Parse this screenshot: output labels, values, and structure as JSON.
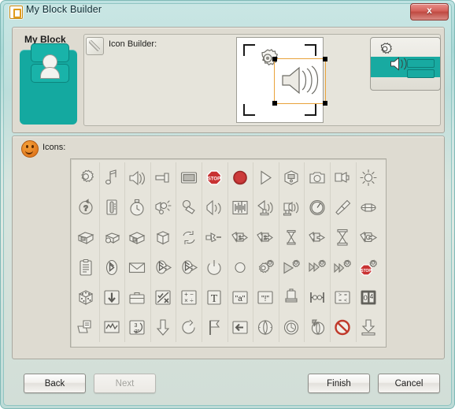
{
  "window": {
    "title": "My Block Builder",
    "title_icon": "block-icon",
    "close_label": "x"
  },
  "left_panel": {
    "heading": "My Block",
    "thumbnail_icon": "my-block-thumbnail",
    "accent_color": "#14a9a0"
  },
  "builder": {
    "pencil_icon": "pencil-icon",
    "label": "Icon Builder:",
    "canvas": {
      "items": [
        "gear-icon",
        "speaker-icon"
      ],
      "selected": "speaker-icon",
      "selection_color": "#e9a23b"
    },
    "preview_icon": "my-block-preview"
  },
  "icons_section": {
    "badge_icon": "smiley-icon",
    "label": "Icons:",
    "grid": {
      "columns": 12,
      "rows": 6,
      "items": [
        "gear-icon",
        "music-note-icon",
        "speaker-icon",
        "flashlight-icon",
        "display-icon",
        "stop-sign-icon",
        "red-button-icon",
        "play-icon",
        "nxt-brick-icon",
        "camera-icon",
        "lamp-icon",
        "sun-icon",
        "question-loop-icon",
        "thermometer-icon",
        "stopwatch-icon",
        "light-sensor-icon",
        "sound-sensor-icon",
        "sound-wave-icon",
        "waveform-icon",
        "satellite-icon",
        "microphone-icon",
        "dial-icon",
        "screwdriver-icon",
        "motor-icon",
        "brick-open-icon",
        "brick-roller-icon",
        "brick-closed-icon",
        "cube-icon",
        "loop-arrows-icon",
        "send-icon",
        "data-in-icon",
        "data-out-icon",
        "hourglass-small-icon",
        "text-send-icon",
        "hourglass-icon",
        "file-send-icon",
        "clipboard-icon",
        "bluetooth-icon",
        "envelope-icon",
        "bluetooth-send-icon",
        "bluetooth-receive-icon",
        "power-icon",
        "circle-icon",
        "gears-icon",
        "play-gear-icon",
        "forward-gear-icon",
        "fast-forward-gear-icon",
        "stop-gear-icon",
        "dice-icon",
        "down-arrow-icon",
        "briefcase-icon",
        "logic-icon",
        "math-icon",
        "text-t-icon",
        "string-a-icon",
        "string-excl-icon",
        "battery-icon",
        "range-icon",
        "compare-icon",
        "number-icon",
        "file-access-icon",
        "graph-icon",
        "duration-icon",
        "arrow-down-icon",
        "rotate-icon",
        "flag-icon",
        "left-arrow-icon",
        "motor-rotate-icon",
        "motor-reset-icon",
        "motor-stop-icon",
        "no-entry-icon",
        "download-icon"
      ]
    }
  },
  "footer": {
    "back": "Back",
    "next": "Next",
    "next_disabled": true,
    "finish": "Finish",
    "cancel": "Cancel"
  }
}
